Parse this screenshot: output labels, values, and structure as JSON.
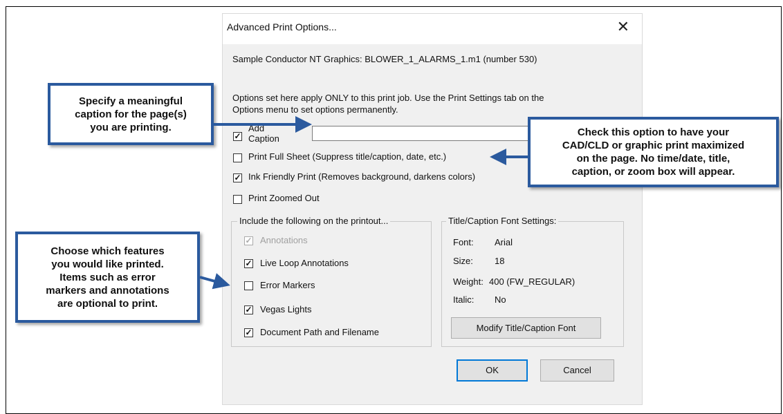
{
  "dialog": {
    "title": "Advanced Print Options...",
    "subtitle": "Sample Conductor NT Graphics: BLOWER_1_ALARMS_1.m1 (number 530)",
    "description": "Options set here apply ONLY to this print job. Use the Print Settings tab on the\nOptions menu to set options permanently.",
    "add_caption": {
      "label_line1": "Add",
      "label_line2": "Caption",
      "checked": true,
      "value": ""
    },
    "options": [
      {
        "label": "Print Full Sheet (Suppress title/caption, date, etc.)",
        "checked": false
      },
      {
        "label": "Ink Friendly Print (Removes background, darkens colors)",
        "checked": true
      },
      {
        "label": "Print Zoomed Out",
        "checked": false
      }
    ],
    "include_group": {
      "title": "Include the following on the printout...",
      "items": [
        {
          "label": "Annotations",
          "checked": true,
          "disabled": true
        },
        {
          "label": "Live Loop Annotations",
          "checked": true,
          "disabled": false
        },
        {
          "label": "Error Markers",
          "checked": false,
          "disabled": false
        },
        {
          "label": "Vegas Lights",
          "checked": true,
          "disabled": false
        },
        {
          "label": "Document Path and Filename",
          "checked": true,
          "disabled": false
        }
      ]
    },
    "font_group": {
      "title": "Title/Caption Font Settings:",
      "rows": [
        {
          "key": "Font:",
          "value": "Arial"
        },
        {
          "key": "Size:",
          "value": "18"
        },
        {
          "key": "Weight:",
          "value": "400 (FW_REGULAR)"
        },
        {
          "key": "Italic:",
          "value": "No"
        }
      ],
      "modify_button": "Modify Title/Caption Font"
    },
    "ok_label": "OK",
    "cancel_label": "Cancel"
  },
  "callouts": {
    "caption": "Specify a meaningful\ncaption for the page(s)\nyou are printing.",
    "full_sheet": "Check this option to have your\nCAD/CLD or graphic print maximized\non the page. No time/date, title,\ncaption, or zoom box will appear.",
    "features": "Choose which features\nyou would like printed.\nItems such as error\nmarkers and annotations\nare optional to print."
  },
  "colors": {
    "callout_border": "#2b5a9e",
    "dialog_bg": "#f0f0f0",
    "accent": "#0078d7"
  },
  "icons": {
    "close": "close-icon",
    "check": "checkmark-icon"
  }
}
